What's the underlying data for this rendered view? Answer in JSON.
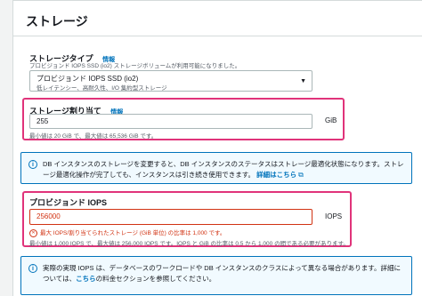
{
  "section": {
    "title": "ストレージ"
  },
  "storage_type": {
    "label": "ストレージタイプ",
    "info_link": "情報",
    "description": "プロビジョンド IOPS SSD (io2) ストレージボリュームが利用可能になりました。",
    "selected_title": "プロビジョンド IOPS SSD (io2)",
    "selected_subtitle": "低レイテンシー、高耐久性、I/O 集約型ストレージ"
  },
  "allocated_storage": {
    "label": "ストレージ割り当て",
    "info_link": "情報",
    "value": "255",
    "unit": "GiB",
    "hint": "最小値は 20 GiB で、最大値は 65,536 GiB です。"
  },
  "notice1": {
    "text": "DB インスタンスのストレージを変更すると、DB インスタンスのステータスはストレージ最適化状態になります。ストレージ最適化操作が完了しても、インスタンスは引き続き使用できます。",
    "link_label": "詳細はこちら"
  },
  "provisioned_iops": {
    "label": "プロビジョンド IOPS",
    "value": "256000",
    "unit": "IOPS",
    "error": "最大 IOPS/割り当てられたストレージ (GiB 単位) の比率は 1,000 です。",
    "hint": "最小値は 1,000 IOPS で、最大値は 256,000 IOPS です。IOPS と GiB の比率は 0.5 から 1,000 の間である必要があります。"
  },
  "notice2": {
    "text_before": "実際の実現 IOPS は、データベースのワークロードや DB インスタンスのクラスによって異なる場合があります。詳細については、",
    "link_label": "こちら",
    "text_after": "の料金セクションを参照してください。"
  },
  "colors": {
    "accent": "#0073bb",
    "error": "#d13212",
    "highlight": "#e0337a"
  }
}
